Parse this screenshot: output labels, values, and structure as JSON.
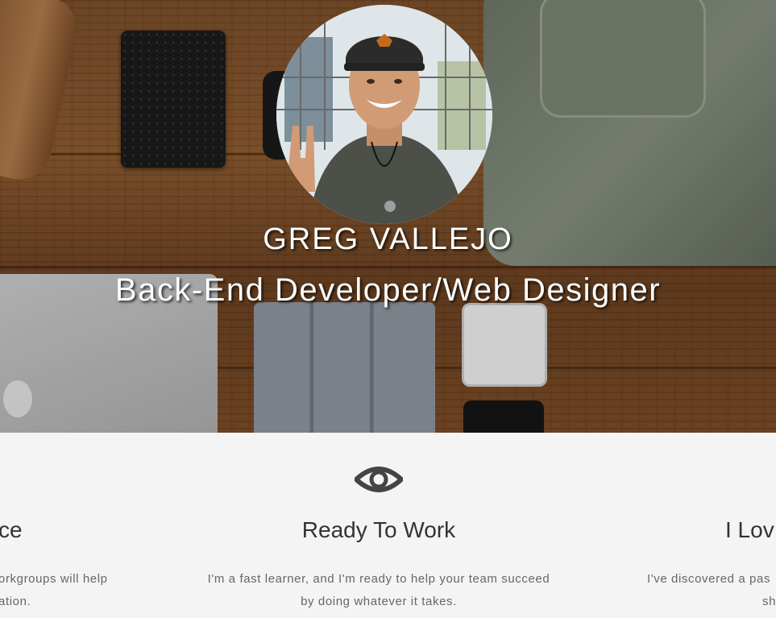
{
  "profile": {
    "name": "GREG VALLEJO",
    "role": "Back-End Developer/Web Designer"
  },
  "features": {
    "left": {
      "title_fragment": "ce",
      "text_line1": "orkgroups will help",
      "text_line2": "ation."
    },
    "center": {
      "icon": "eye-icon",
      "title": "Ready To Work",
      "text_line1": "I'm a fast learner, and I'm ready to help your team succeed",
      "text_line2": "by doing whatever it takes."
    },
    "right": {
      "title_fragment": "I Lov",
      "text_line1": "I've discovered a pas",
      "text_line2": "sh"
    }
  },
  "colors": {
    "text_light": "#ffffff",
    "heading": "#333333",
    "body": "#666666",
    "section_bg": "#f4f4f4",
    "icon": "#444444"
  }
}
